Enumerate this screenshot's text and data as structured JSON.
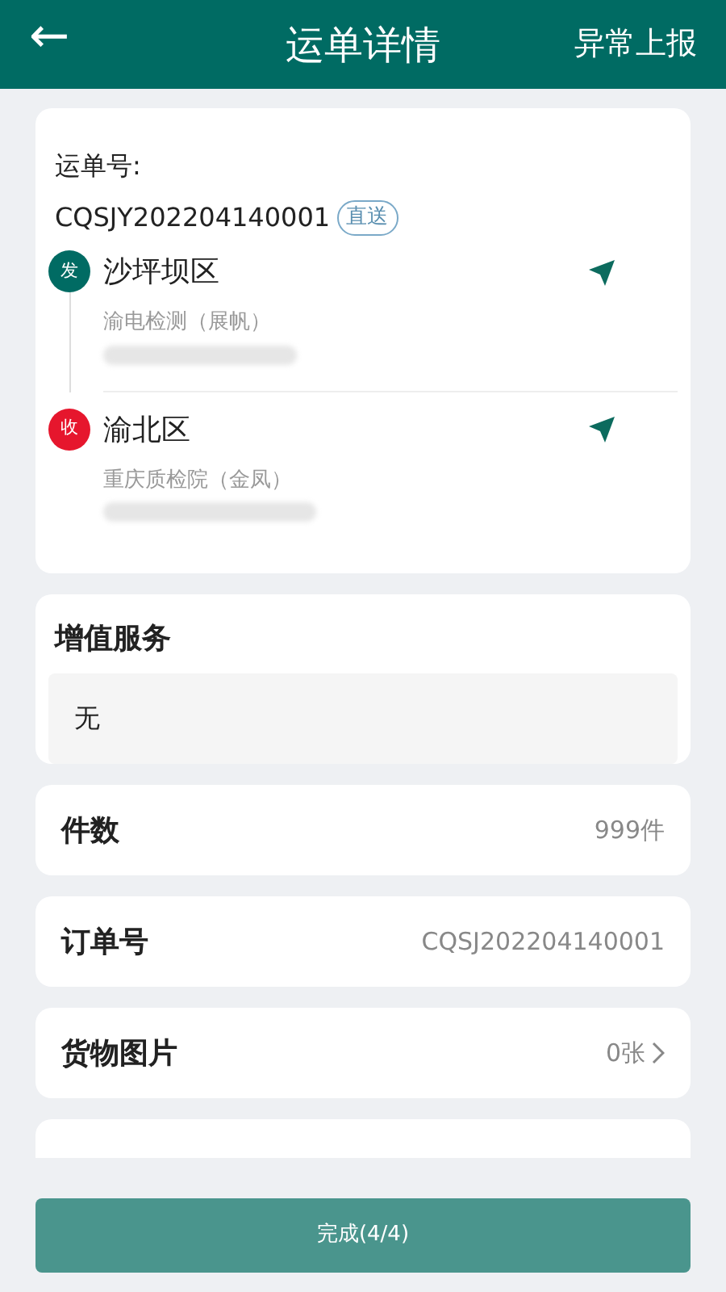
{
  "header": {
    "back": "←",
    "title": "运单详情",
    "action": "异常上报"
  },
  "waybill": {
    "label": "运单号:",
    "number": "CQSJY202204140001",
    "tag": "直送",
    "stops": [
      {
        "kind": "send",
        "badge": "发",
        "district": "沙坪坝区",
        "contact": "渝电检测（展帆）"
      },
      {
        "kind": "receive",
        "badge": "收",
        "district": "渝北区",
        "contact": "重庆质检院（金凤）"
      }
    ]
  },
  "services": {
    "title": "增值服务",
    "value": "无"
  },
  "rows": [
    {
      "label": "件数",
      "value": "999件",
      "link": false
    },
    {
      "label": "订单号",
      "value": "CQSJ202204140001",
      "link": false
    },
    {
      "label": "货物图片",
      "value": "0张",
      "link": true
    }
  ],
  "complete_button": "完成(4/4)"
}
